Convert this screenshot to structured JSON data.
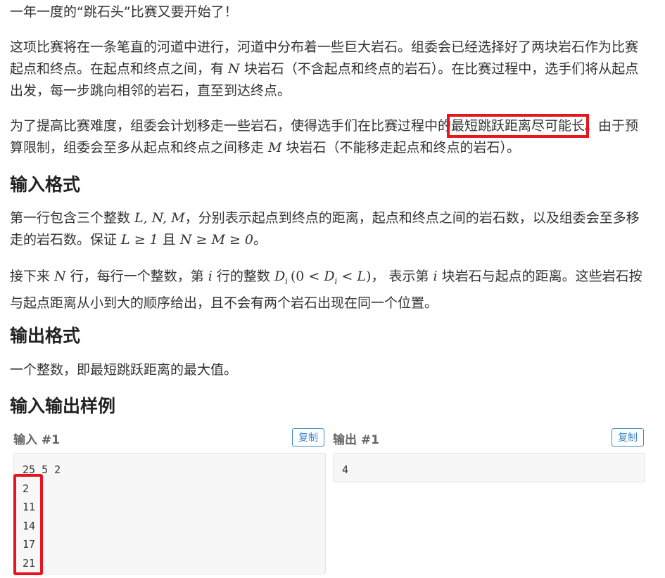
{
  "p_intro": "一年一度的“跳石头”比赛又要开始了！",
  "p_desc1_a": "这项比赛将在一条笔直的河道中进行，河道中分布着一些巨大岩石。组委会已经选择好了两块岩石作为比赛起点和终点。在起点和终点之间，有 ",
  "var_N": "N",
  "p_desc1_b": " 块岩石（不含起点和终点的岩石）。在比赛过程中，选手们将从起点出发，每一步跳向相邻的岩石，直至到达终点。",
  "p_desc2_a": "为了提高比赛难度，组委会计划移走一些岩石，使得选手们在比赛过程中的",
  "p_desc2_hl": "最短跳跃距离尽可能长",
  "p_desc2_b": "。由于预算限制，组委会至多从起点和终点之间移走 ",
  "var_M": "M",
  "p_desc2_c": " 块岩石（不能移走起点和终点的岩石）。",
  "h_input": "输入格式",
  "p_in1_a": "第一行包含三个整数 ",
  "p_in1_vars": "L, N, M",
  "p_in1_b": "，分别表示起点到终点的距离，起点和终点之间的岩石数，以及组委会至多移走的岩石数。保证 ",
  "p_in1_cond": "L ≥ 1",
  "p_in1_c": " 且 ",
  "p_in1_cond2": "N ≥ M ≥ 0",
  "p_in1_d": "。",
  "p_in2_a": "接下来 ",
  "p_in2_b": " 行，每行一个整数，第 ",
  "var_i": "i",
  "p_in2_c": " 行的整数 ",
  "var_D": "D",
  "p_in2_range_a": "(0 < ",
  "p_in2_range_b": " < ",
  "var_L": "L",
  "p_in2_range_c": ")",
  "p_in2_d": "， 表示第 ",
  "p_in2_e": " 块岩石与起点的距离。这些岩石按与起点距离从小到大的顺序给出，且不会有两个岩石出现在同一个位置。",
  "h_output": "输出格式",
  "p_out": "一个整数，即最短跳跃距离的最大值。",
  "h_sample": "输入输出样例",
  "sample_in_label": "输入 #1",
  "sample_out_label": "输出 #1",
  "copy_label": "复制",
  "sample_in_lines": [
    "25 5 2",
    "2",
    "11",
    "14",
    "17",
    "21"
  ],
  "sample_out_lines": [
    "4"
  ],
  "colors": {
    "highlight": "#e8141e",
    "link": "#3d87c7"
  }
}
